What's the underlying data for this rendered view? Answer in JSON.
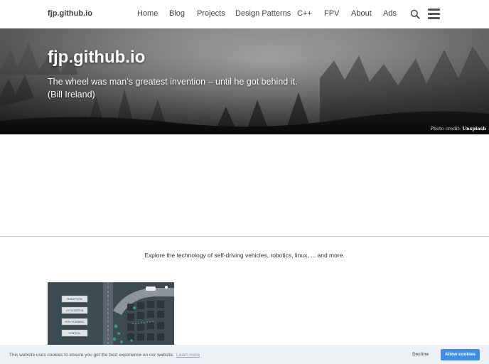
{
  "navbar": {
    "brand": "fjp.github.io",
    "links": [
      "Home",
      "Blog",
      "Projects",
      "Design Patterns",
      "C++",
      "FPV",
      "About",
      "Ads"
    ],
    "search_icon": "search-icon",
    "menu_icon": "hamburger-menu-icon"
  },
  "hero": {
    "title": "fjp.github.io",
    "quote": "The wheel was man’s greatest invention – until he got behind it. (Bill Ireland)",
    "photo_credit_prefix": "Photo credit: ",
    "photo_credit_source": "Unsplash"
  },
  "main": {
    "tagline": "Explore the technology of self-driving vehicles, robotics, linux, ... and more.",
    "post_image_labels": [
      "PERCEPTION",
      "LOCALIZATION",
      "PATH PLANNING",
      "CONTROL"
    ]
  },
  "cookie_banner": {
    "message": "This website uses cookies to ensure you get the best experience on our website.",
    "learn_more": "Learn more",
    "decline": "Decline",
    "allow": "Allow cookies"
  },
  "colors": {
    "allow_button": "#3c8fe2",
    "banner_bg": "#edf0f4"
  }
}
